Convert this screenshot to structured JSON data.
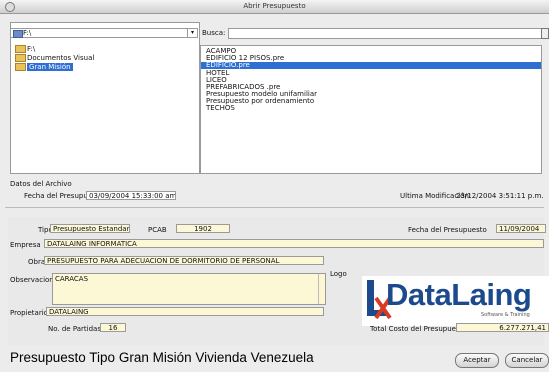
{
  "window": {
    "title": "Abrir Presupuesto"
  },
  "tree": {
    "combo_value": "F:\\",
    "items": [
      {
        "label": "F:\\"
      },
      {
        "label": "Documentos Visual"
      },
      {
        "label": "Gran Misión"
      }
    ]
  },
  "search": {
    "label": "Busca:",
    "value": ""
  },
  "files": [
    {
      "name": "ACAMPO"
    },
    {
      "name": "EDIFICIO 12 PISOS.pre"
    },
    {
      "name": "EDIFICIO.pre",
      "selected": true
    },
    {
      "name": "HOTEL"
    },
    {
      "name": "LICEO"
    },
    {
      "name": "PREFABRICADOS .pre"
    },
    {
      "name": "Presupuesto modelo unifamiliar"
    },
    {
      "name": "Presupuesto por ordenamiento"
    },
    {
      "name": "TECHOS"
    }
  ],
  "archive": {
    "section_label": "Datos del Archivo",
    "date_label": "Fecha del Presupuesto",
    "date_value": "03/09/2004  15:33:00 am",
    "mod_label": "Ultima Modificación:",
    "mod_value": "23/12/2004 3:51:11 p.m."
  },
  "budget": {
    "type_label": "Tipo",
    "type_value": "Presupuesto Estandar",
    "pcab_label": "PCAB",
    "pcab_value": "1902",
    "date_label": "Fecha del Presupuesto",
    "date_value": "11/09/2004",
    "company_label": "Empresa",
    "company_value": "DATALAING INFORMATICA",
    "client_label": "Obra:",
    "client_value": "PRESUPUESTO PARA ADECUACION DE DORMITORIO DE PERSONAL",
    "notes_label": "Observaciones",
    "notes_value": "CARACAS",
    "logo_label": "Logo",
    "owner_label": "Propietario",
    "owner_value": "DATALAING",
    "parts_label": "No. de Partidas",
    "parts_value": "16",
    "total_label": "Total Costo del Presupuesto",
    "total_value": "6.277.271,41"
  },
  "logo": {
    "text": "DataLaing",
    "subtitle": "Software & Training"
  },
  "footer": {
    "title": "Presupuesto Tipo Gran Misión Vivienda Venezuela",
    "accept_label": "Aceptar",
    "cancel_label": "Cancelar"
  },
  "colors": {
    "selection": "#2e6fd1",
    "field_yellow": "#fcf8d6",
    "logo_blue": "#1d4a8c",
    "logo_red": "#d83a22"
  }
}
